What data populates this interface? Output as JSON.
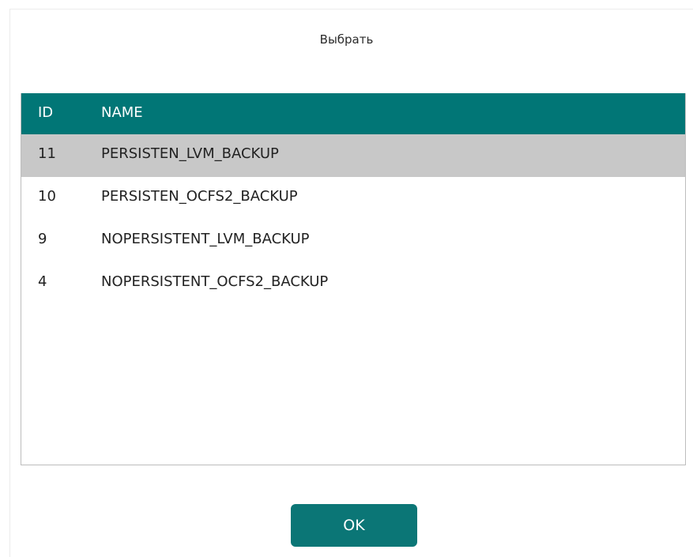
{
  "dialog": {
    "title": "Выбрать",
    "ok_label": "OK"
  },
  "table": {
    "columns": [
      "ID",
      "NAME"
    ],
    "rows": [
      {
        "id": "11",
        "name": "PERSISTEN_LVM_BACKUP",
        "selected": true
      },
      {
        "id": "10",
        "name": "PERSISTEN_OCFS2_BACKUP",
        "selected": false
      },
      {
        "id": "9",
        "name": "NOPERSISTENT_LVM_BACKUP",
        "selected": false
      },
      {
        "id": "4",
        "name": "NOPERSISTENT_OCFS2_BACKUP",
        "selected": false
      }
    ]
  },
  "colors": {
    "header_bg": "#017676",
    "selected_row_bg": "#c8c8c8",
    "button_bg": "#0b7676"
  }
}
